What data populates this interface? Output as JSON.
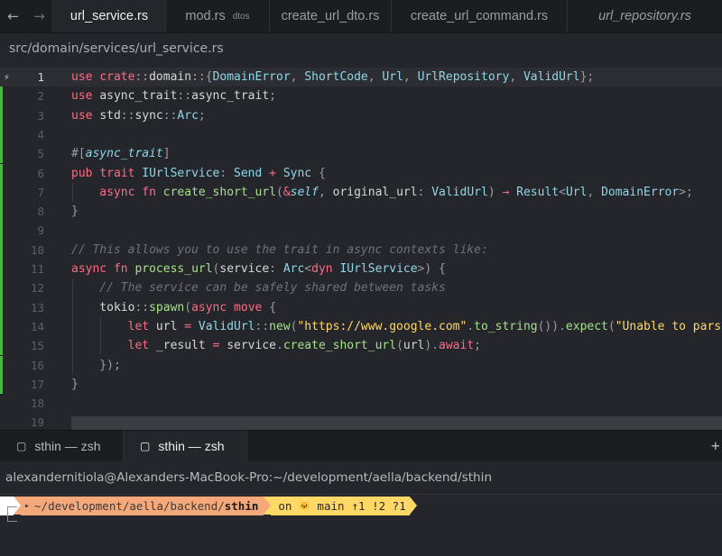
{
  "nav": {
    "back_icon": "arrow-left-icon",
    "forward_icon": "arrow-right-icon"
  },
  "tabs": [
    {
      "label": "url_service.rs",
      "hint": "",
      "active": true,
      "italic": false
    },
    {
      "label": "mod.rs",
      "hint": "dtos",
      "active": false,
      "italic": false
    },
    {
      "label": "create_url_dto.rs",
      "hint": "",
      "active": false,
      "italic": false
    },
    {
      "label": "create_url_command.rs",
      "hint": "",
      "active": false,
      "italic": false
    },
    {
      "label": "url_repository.rs",
      "hint": "",
      "active": false,
      "italic": true
    }
  ],
  "breadcrumb": "src/domain/services/url_service.rs",
  "editor": {
    "current_line": 1,
    "line_numbers": [
      "1",
      "2",
      "3",
      "4",
      "5",
      "6",
      "7",
      "8",
      "9",
      "10",
      "11",
      "12",
      "13",
      "14",
      "15",
      "16",
      "17",
      "18",
      "19"
    ],
    "lines": [
      [
        [
          "k",
          "use "
        ],
        [
          "k",
          "crate"
        ],
        [
          "p",
          "::"
        ],
        [
          "",
          "domain"
        ],
        [
          "p",
          "::{"
        ],
        [
          "t",
          "DomainError"
        ],
        [
          "p",
          ", "
        ],
        [
          "t",
          "ShortCode"
        ],
        [
          "p",
          ", "
        ],
        [
          "t",
          "Url"
        ],
        [
          "p",
          ", "
        ],
        [
          "t",
          "UrlRepository"
        ],
        [
          "p",
          ", "
        ],
        [
          "t",
          "ValidUrl"
        ],
        [
          "p",
          "};"
        ]
      ],
      [
        [
          "k",
          "use "
        ],
        [
          "",
          "async_trait"
        ],
        [
          "p",
          "::"
        ],
        [
          "",
          "async_trait"
        ],
        [
          "p",
          ";"
        ]
      ],
      [
        [
          "k",
          "use "
        ],
        [
          "",
          "std"
        ],
        [
          "p",
          "::"
        ],
        [
          "",
          "sync"
        ],
        [
          "p",
          "::"
        ],
        [
          "t",
          "Arc"
        ],
        [
          "p",
          ";"
        ]
      ],
      [],
      [
        [
          "p",
          "#["
        ],
        [
          "a",
          "async_trait"
        ],
        [
          "p",
          "]"
        ]
      ],
      [
        [
          "k",
          "pub "
        ],
        [
          "k",
          "trait "
        ],
        [
          "t",
          "IUrlService"
        ],
        [
          "p",
          ": "
        ],
        [
          "t",
          "Send"
        ],
        [
          "k",
          " + "
        ],
        [
          "t",
          "Sync"
        ],
        [
          "p",
          " {"
        ]
      ],
      [
        [
          "",
          ""
        ],
        [
          "k",
          "    async "
        ],
        [
          "k",
          "fn "
        ],
        [
          "f",
          "create_short_url"
        ],
        [
          "p",
          "("
        ],
        [
          "k",
          "&"
        ],
        [
          "a",
          "self"
        ],
        [
          "p",
          ", "
        ],
        [
          "",
          "original_url"
        ],
        [
          "p",
          ": "
        ],
        [
          "t",
          "ValidUrl"
        ],
        [
          "p",
          ") "
        ],
        [
          "k",
          "→ "
        ],
        [
          "t",
          "Result"
        ],
        [
          "p",
          "<"
        ],
        [
          "t",
          "Url"
        ],
        [
          "p",
          ", "
        ],
        [
          "t",
          "DomainError"
        ],
        [
          "p",
          ">;"
        ]
      ],
      [
        [
          "p",
          "}"
        ]
      ],
      [],
      [
        [
          "c",
          "// This allows you to use the trait in async contexts like:"
        ]
      ],
      [
        [
          "k",
          "async "
        ],
        [
          "k",
          "fn "
        ],
        [
          "f",
          "process_url"
        ],
        [
          "p",
          "("
        ],
        [
          "",
          "service"
        ],
        [
          "p",
          ": "
        ],
        [
          "t",
          "Arc"
        ],
        [
          "p",
          "<"
        ],
        [
          "k",
          "dyn "
        ],
        [
          "t",
          "IUrlService"
        ],
        [
          "p",
          ">) {"
        ]
      ],
      [
        [
          "c",
          "    // The service can be safely shared between tasks"
        ]
      ],
      [
        [
          "",
          "    tokio"
        ],
        [
          "p",
          "::"
        ],
        [
          "f",
          "spawn"
        ],
        [
          "p",
          "("
        ],
        [
          "k",
          "async "
        ],
        [
          "k",
          "move "
        ],
        [
          "p",
          "{"
        ]
      ],
      [
        [
          "k",
          "        let "
        ],
        [
          "",
          "url"
        ],
        [
          "k",
          " = "
        ],
        [
          "t",
          "ValidUrl"
        ],
        [
          "p",
          "::"
        ],
        [
          "f",
          "new"
        ],
        [
          "p",
          "("
        ],
        [
          "s",
          "\"https://www.google.com\""
        ],
        [
          "p",
          "."
        ],
        [
          "f",
          "to_string"
        ],
        [
          "p",
          "())."
        ],
        [
          "f",
          "expect"
        ],
        [
          "p",
          "("
        ],
        [
          "s",
          "\"Unable to parse"
        ]
      ],
      [
        [
          "k",
          "        let "
        ],
        [
          "",
          "_result"
        ],
        [
          "k",
          " = "
        ],
        [
          "",
          "service"
        ],
        [
          "p",
          "."
        ],
        [
          "f",
          "create_short_url"
        ],
        [
          "p",
          "("
        ],
        [
          "",
          "url"
        ],
        [
          "p",
          ")."
        ],
        [
          "k",
          "await"
        ],
        [
          "p",
          ";"
        ]
      ],
      [
        [
          "p",
          "    });"
        ]
      ],
      [
        [
          "p",
          "}"
        ]
      ],
      [],
      []
    ]
  },
  "terminal": {
    "tabs": [
      {
        "label": "sthin — zsh",
        "active": false
      },
      {
        "label": "sthin — zsh",
        "active": true
      }
    ],
    "plus_label": "+",
    "title": "alexandernitiola@Alexanders-MacBook-Pro:~/development/aella/backend/sthin",
    "prompt": {
      "apple_icon": "",
      "folder_icon": "▸",
      "path_prefix": "~/development/aella/backend/",
      "path_dir": "sthin",
      "git_text": "on ",
      "github_icon": "🐱",
      "branch_icon": "",
      "branch": "main",
      "status": "↑1 !2 ?1"
    }
  },
  "colors": {
    "added_line_marker": "#4bb543",
    "accent_path": "#f5a87a",
    "accent_git": "#ffd866"
  }
}
